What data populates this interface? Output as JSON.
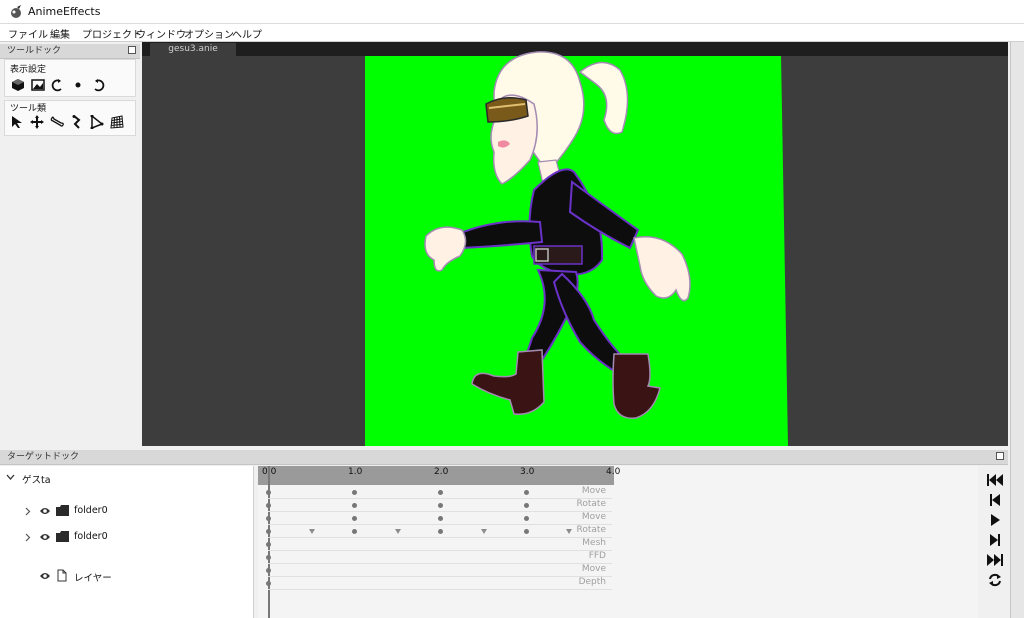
{
  "window": {
    "title": "AnimeEffects"
  },
  "menu": {
    "items": [
      "ファイル",
      "編集",
      "プロジェクト",
      "ウィンドウ",
      "オプション",
      "ヘルプ"
    ]
  },
  "tool_dock": {
    "title": "ツールドック",
    "display_group_label": "表示設定",
    "tools_group_label": "ツール類",
    "display_icons": [
      "cube-icon",
      "image-icon",
      "rotate-left-icon",
      "dot-icon",
      "rotate-right-icon"
    ],
    "tool_icons": [
      "cursor-icon",
      "move-icon",
      "bone-icon",
      "pose-icon",
      "mesh-icon",
      "ffd-grid-icon"
    ]
  },
  "canvas": {
    "tab_label": "gesu3.anie",
    "background_color": "#00ff00"
  },
  "target_dock": {
    "title": "ターゲットドック",
    "root_label": "ゲスta",
    "tree": [
      {
        "label": "folder0",
        "type": "folder"
      },
      {
        "label": "folder0",
        "type": "folder"
      },
      {
        "label": "レイヤー",
        "type": "layer"
      }
    ]
  },
  "timeline": {
    "ruler_labels": [
      "0.0",
      "1.0",
      "2.0",
      "3.0",
      "4.0"
    ],
    "tracks": [
      "Move",
      "Rotate",
      "Move",
      "Rotate",
      "Mesh",
      "FFD",
      "Move",
      "Depth"
    ]
  },
  "player_controls": [
    "skip-to-start-icon",
    "step-back-icon",
    "play-icon",
    "step-forward-icon",
    "skip-to-end-icon",
    "loop-icon"
  ],
  "colors": {
    "canvas_green": "#00ff00",
    "canvas_backdrop": "#3d3d3d",
    "ruler": "#9a9a9a"
  }
}
